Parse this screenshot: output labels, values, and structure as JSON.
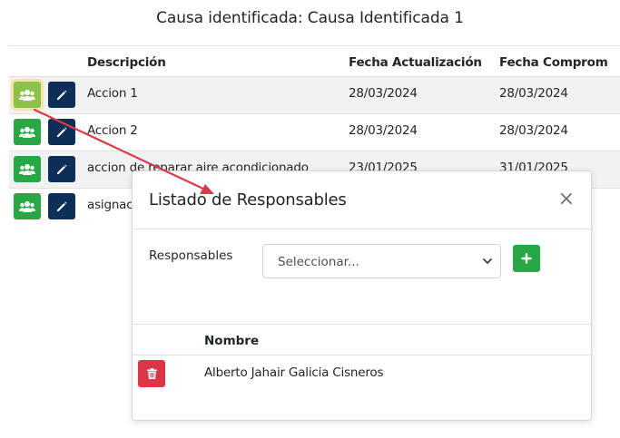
{
  "page": {
    "title": "Causa identificada: Causa Identificada 1"
  },
  "table": {
    "columns": [
      "Descripción",
      "Fecha Actualización",
      "Fecha Comprom"
    ],
    "rows": [
      {
        "descripcion": "Accion 1",
        "fecha_actualizacion": "28/03/2024",
        "fecha_compromiso": "28/03/2024"
      },
      {
        "descripcion": "Accion 2",
        "fecha_actualizacion": "28/03/2024",
        "fecha_compromiso": "28/03/2024"
      },
      {
        "descripcion": "accion de reparar aire acondicionado",
        "fecha_actualizacion": "23/01/2025",
        "fecha_compromiso": "31/01/2025"
      },
      {
        "descripcion": "asignac",
        "fecha_actualizacion": "",
        "fecha_compromiso": ""
      }
    ]
  },
  "modal": {
    "title": "Listado de Responsables",
    "close_label": "×",
    "responsables_label": "Responsables",
    "select_value": "Seleccionar...",
    "table_header": "Nombre",
    "rows": [
      {
        "nombre": "Alberto Jahair Galicia Cisneros"
      }
    ]
  },
  "colors": {
    "success": "#28a745",
    "primary_dark": "#0d2e57",
    "danger": "#dc3545",
    "annotation_arrow": "#d93a4a"
  },
  "icons": {
    "users": "users-icon",
    "edit": "pencil-icon",
    "add": "plus-icon",
    "delete": "trash-icon",
    "caret": "chevron-down-icon"
  }
}
